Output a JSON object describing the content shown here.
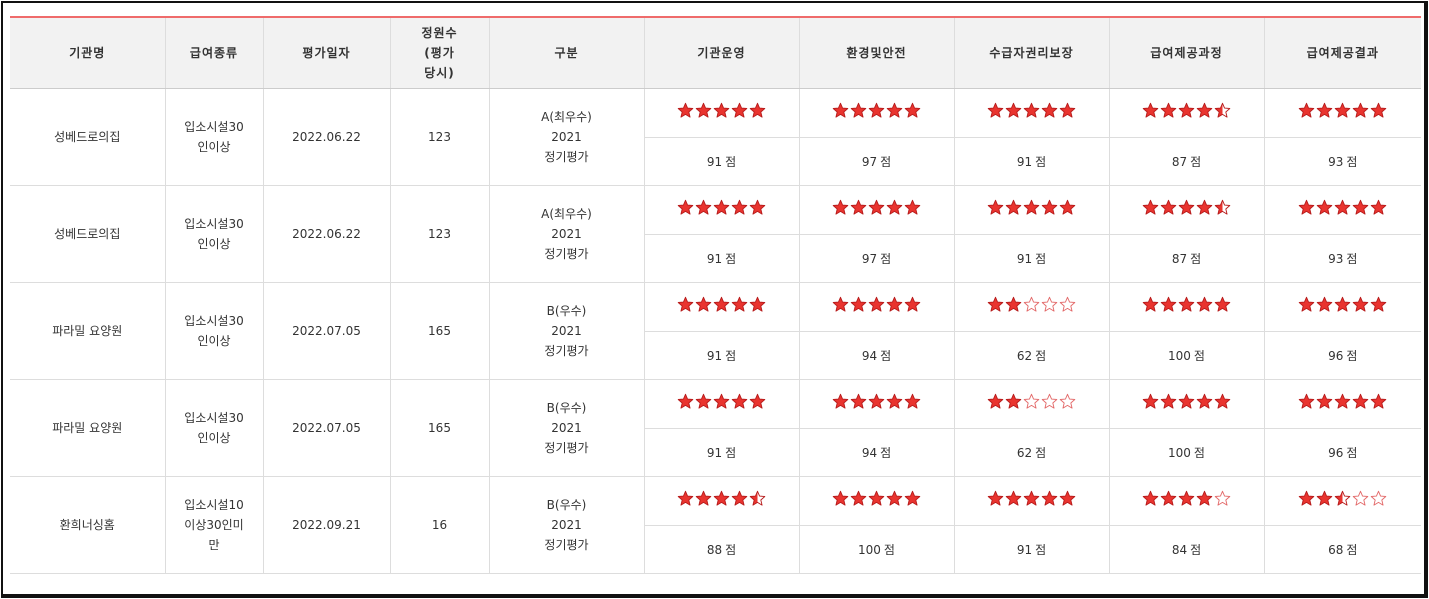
{
  "colors": {
    "accent_line": "#ef6b6b",
    "star_fill": "#e9342f",
    "star_outline": "#e36a6a",
    "header_bg": "#f2f2f2"
  },
  "headers": [
    "기관명",
    "급여종류",
    "평가일자",
    "정원수\n(평가\n당시)",
    "구분",
    "기관운영",
    "환경및안전",
    "수급자권리보장",
    "급여제공과정",
    "급여제공결과"
  ],
  "score_unit": "점",
  "rows": [
    {
      "name": "성베드로의집",
      "type": "입소시설30\n인이상",
      "date": "2022.06.22",
      "capacity": "123",
      "grade": "A(최우수)\n2021\n정기평가",
      "ratings": [
        5,
        5,
        5,
        4.5,
        5
      ],
      "scores": [
        "91",
        "97",
        "91",
        "87",
        "93"
      ]
    },
    {
      "name": "성베드로의집",
      "type": "입소시설30\n인이상",
      "date": "2022.06.22",
      "capacity": "123",
      "grade": "A(최우수)\n2021\n정기평가",
      "ratings": [
        5,
        5,
        5,
        4.5,
        5
      ],
      "scores": [
        "91",
        "97",
        "91",
        "87",
        "93"
      ]
    },
    {
      "name": "파라밀 요양원",
      "type": "입소시설30\n인이상",
      "date": "2022.07.05",
      "capacity": "165",
      "grade": "B(우수)\n2021\n정기평가",
      "ratings": [
        5,
        5,
        2,
        5,
        5
      ],
      "scores": [
        "91",
        "94",
        "62",
        "100",
        "96"
      ]
    },
    {
      "name": "파라밀 요양원",
      "type": "입소시설30\n인이상",
      "date": "2022.07.05",
      "capacity": "165",
      "grade": "B(우수)\n2021\n정기평가",
      "ratings": [
        5,
        5,
        2,
        5,
        5
      ],
      "scores": [
        "91",
        "94",
        "62",
        "100",
        "96"
      ]
    },
    {
      "name": "환희너싱홈",
      "type": "입소시설10\n이상30인미\n만",
      "date": "2022.09.21",
      "capacity": "16",
      "grade": "B(우수)\n2021\n정기평가",
      "ratings": [
        4.5,
        5,
        5,
        4,
        2.5
      ],
      "scores": [
        "88",
        "100",
        "91",
        "84",
        "68"
      ]
    }
  ]
}
